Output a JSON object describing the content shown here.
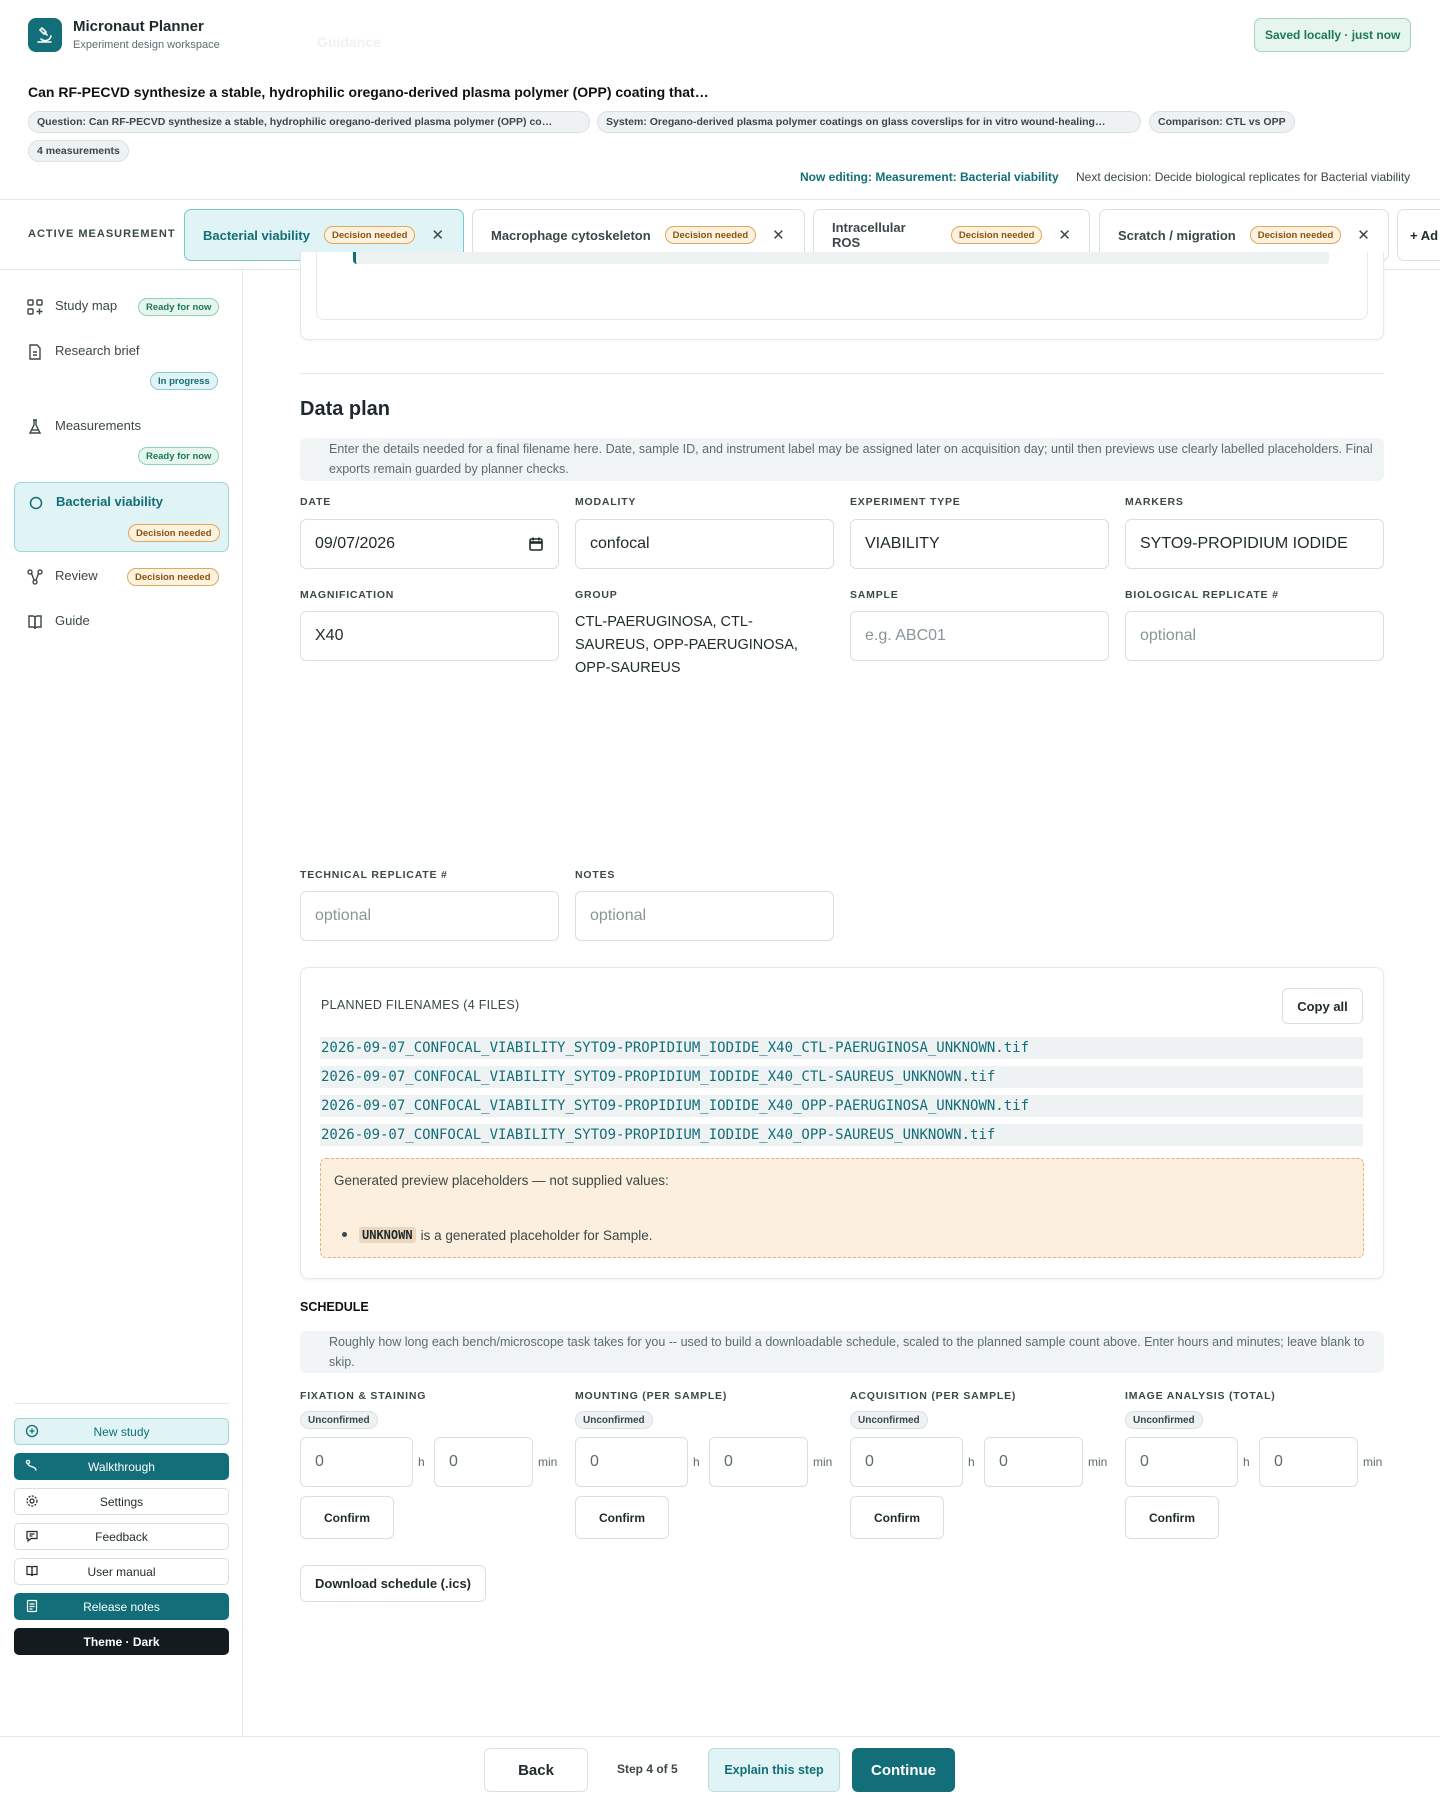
{
  "app": {
    "name": "Micronaut Planner",
    "subtitle": "Experiment design workspace",
    "ghost_tab": "Guidance",
    "saved": "Saved locally · just now"
  },
  "study": {
    "title": "Can RF-PECVD synthesize a stable, hydrophilic oregano-derived plasma polymer (OPP) coating that…",
    "chips": [
      "Question: Can RF-PECVD synthesize a stable, hydrophilic oregano-derived plasma polymer (OPP) co…",
      "System: Oregano-derived plasma polymer coatings on glass coverslips for in vitro wound-healing…",
      "Comparison: CTL vs OPP",
      "4 measurements"
    ],
    "now_editing": "Now editing: Measurement: Bacterial viability",
    "next_decision": "Next decision: Decide biological replicates for Bacterial viability"
  },
  "tabs": {
    "label": "ACTIVE MEASUREMENT",
    "items": [
      {
        "name": "Bacterial viability",
        "badge": "Decision needed"
      },
      {
        "name": "Macrophage cytoskeleton",
        "badge": "Decision needed"
      },
      {
        "name": "Intracellular ROS",
        "badge": "Decision needed"
      },
      {
        "name": "Scratch / migration",
        "badge": "Decision needed"
      }
    ],
    "add": "+ Ad"
  },
  "sidebar": {
    "items": [
      {
        "label": "Study map",
        "badge": "Ready for now"
      },
      {
        "label": "Research brief",
        "badge": "In progress"
      },
      {
        "label": "Measurements",
        "badge": "Ready for now"
      },
      {
        "label": "Bacterial viability",
        "badge": "Decision needed"
      },
      {
        "label": "Review",
        "badge": "Decision needed"
      },
      {
        "label": "Guide"
      }
    ],
    "buttons": {
      "new_study": "New study",
      "walkthrough": "Walkthrough",
      "settings": "Settings",
      "feedback": "Feedback",
      "manual": "User manual",
      "release": "Release notes",
      "theme": "Theme · Dark"
    }
  },
  "data_plan": {
    "title": "Data plan",
    "hint": "Enter the details needed for a final filename here. Date, sample ID, and instrument label may be assigned later on acquisition day; until then previews use clearly labelled placeholders. Final exports remain guarded by planner checks.",
    "fields": {
      "date": {
        "label": "DATE",
        "value": "09/07/2026"
      },
      "modality": {
        "label": "MODALITY",
        "value": "confocal"
      },
      "experiment_type": {
        "label": "EXPERIMENT TYPE",
        "value": "VIABILITY"
      },
      "markers": {
        "label": "MARKERS",
        "value": "SYTO9-PROPIDIUM IODIDE"
      },
      "magnification": {
        "label": "MAGNIFICATION",
        "value": "X40"
      },
      "group": {
        "label": "GROUP",
        "value": "CTL-PAERUGINOSA, CTL-SAUREUS, OPP-PAERUGINOSA, OPP-SAUREUS"
      },
      "sample": {
        "label": "SAMPLE",
        "placeholder": "e.g. ABC01"
      },
      "bio_rep": {
        "label": "BIOLOGICAL REPLICATE #",
        "placeholder": "optional"
      },
      "tech_rep": {
        "label": "TECHNICAL REPLICATE #",
        "placeholder": "optional"
      },
      "notes": {
        "label": "NOTES",
        "placeholder": "optional"
      }
    },
    "filenames": {
      "title": "PLANNED FILENAMES (4 FILES)",
      "copy": "Copy all",
      "items": [
        "2026-09-07_CONFOCAL_VIABILITY_SYTO9-PROPIDIUM_IODIDE_X40_CTL-PAERUGINOSA_UNKNOWN.tif",
        "2026-09-07_CONFOCAL_VIABILITY_SYTO9-PROPIDIUM_IODIDE_X40_CTL-SAUREUS_UNKNOWN.tif",
        "2026-09-07_CONFOCAL_VIABILITY_SYTO9-PROPIDIUM_IODIDE_X40_OPP-PAERUGINOSA_UNKNOWN.tif",
        "2026-09-07_CONFOCAL_VIABILITY_SYTO9-PROPIDIUM_IODIDE_X40_OPP-SAUREUS_UNKNOWN.tif"
      ],
      "warn_title": "Generated preview placeholders — not supplied values:",
      "warn_token": "UNKNOWN",
      "warn_text": "is a generated placeholder for Sample."
    }
  },
  "schedule": {
    "title": "SCHEDULE",
    "hint": "Roughly how long each bench/microscope task takes for you -- used to build a downloadable schedule, scaled to the planned sample count above. Enter hours and minutes; leave blank to skip.",
    "status": "Unconfirmed",
    "hours_unit": "h",
    "min_unit": "min",
    "hours_placeholder": "0",
    "min_placeholder": "0",
    "confirm": "Confirm",
    "tasks": [
      "FIXATION & STAINING",
      "MOUNTING (PER SAMPLE)",
      "ACQUISITION (PER SAMPLE)",
      "IMAGE ANALYSIS (TOTAL)"
    ],
    "download": "Download schedule (.ics)"
  },
  "footer": {
    "back": "Back",
    "step": "Step 4 of 5",
    "explain": "Explain this step",
    "continue": "Continue"
  }
}
